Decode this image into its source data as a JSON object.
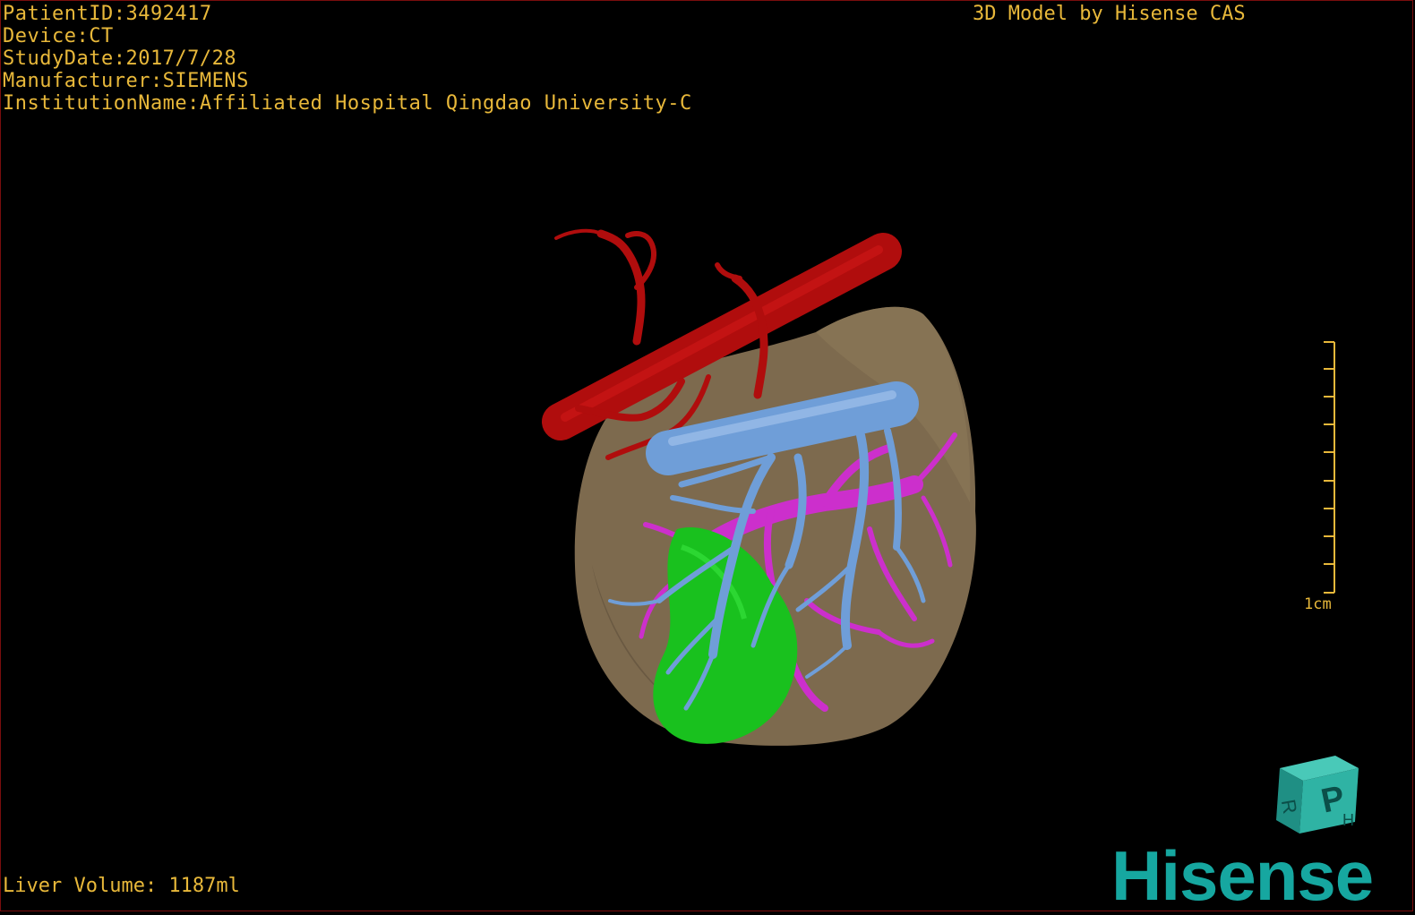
{
  "info": {
    "patient_id": "PatientID:3492417",
    "device": "Device:CT",
    "study_date": "StudyDate:2017/7/28",
    "manufacturer": "Manufacturer:SIEMENS",
    "institution": "InstitutionName:Affiliated Hospital Qingdao University-C"
  },
  "brand_text": "3D Model by Hisense CAS",
  "liver_volume": "Liver Volume: 1187ml",
  "scale": {
    "label": "1cm"
  },
  "logo_text": "Hisense",
  "orientation_cube": {
    "front_letter": "P",
    "side_letter": "H",
    "bottom_letter": "R",
    "color": "#2fb3a4"
  },
  "colors": {
    "text": "#e8b83a",
    "liver": "#7d6a4e",
    "artery": "#b00d0d",
    "vein": "#6f9ed8",
    "portal": "#cc2fcc",
    "gallbladder": "#19c11e",
    "brand": "#16a7a0"
  }
}
